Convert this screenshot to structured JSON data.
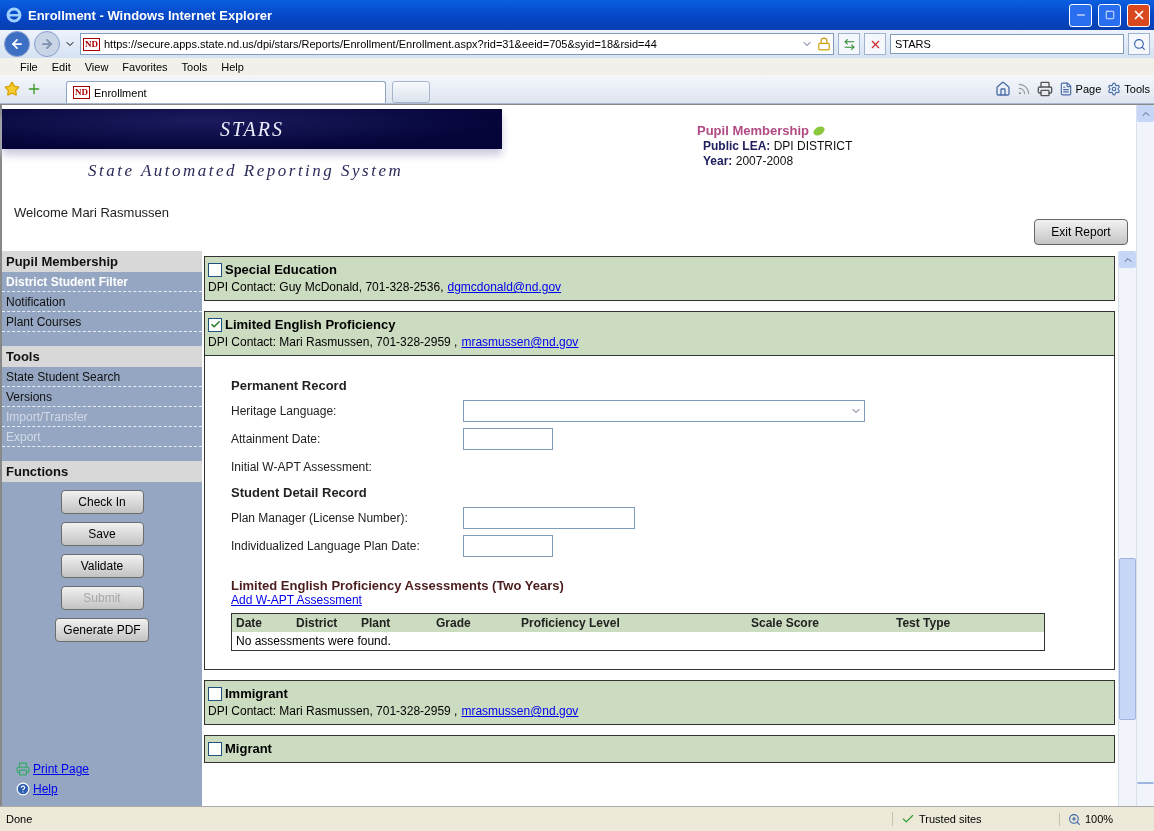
{
  "window": {
    "title": "Enrollment - Windows Internet Explorer"
  },
  "address_bar": {
    "site_badge": "ND",
    "url": "https://secure.apps.state.nd.us/dpi/stars/Reports/Enrollment/Enrollment.aspx?rid=31&eeid=705&syid=18&rsid=44",
    "search": "STARS"
  },
  "menu": [
    "File",
    "Edit",
    "View",
    "Favorites",
    "Tools",
    "Help"
  ],
  "tab": {
    "site_badge": "ND",
    "label": "Enrollment"
  },
  "command_bar": [
    "Page",
    "Tools"
  ],
  "header": {
    "logo_title": "STARS",
    "logo_subtitle": "State Automated Reporting System",
    "welcome": "Welcome Mari Rasmussen",
    "report_title": "Pupil Membership",
    "lea_label": "Public LEA:",
    "lea_value": "DPI DISTRICT",
    "year_label": "Year:",
    "year_value": "2007-2008",
    "exit_button": "Exit Report"
  },
  "sidebar": {
    "groups": [
      {
        "title": "Pupil Membership",
        "items": [
          {
            "label": "District Student Filter",
            "selected": true,
            "disabled": false
          },
          {
            "label": "Notification",
            "selected": false,
            "disabled": false
          },
          {
            "label": "Plant Courses",
            "selected": false,
            "disabled": false
          }
        ]
      },
      {
        "title": "Tools",
        "items": [
          {
            "label": "State Student Search",
            "selected": false,
            "disabled": false
          },
          {
            "label": "Versions",
            "selected": false,
            "disabled": false
          },
          {
            "label": "Import/Transfer",
            "selected": false,
            "disabled": true
          },
          {
            "label": "Export",
            "selected": false,
            "disabled": true
          }
        ]
      }
    ],
    "functions_title": "Functions",
    "buttons": [
      {
        "label": "Check In",
        "disabled": false
      },
      {
        "label": "Save",
        "disabled": false
      },
      {
        "label": "Validate",
        "disabled": false
      },
      {
        "label": "Submit",
        "disabled": true
      },
      {
        "label": "Generate PDF",
        "disabled": false
      }
    ],
    "links": [
      {
        "kind": "print",
        "label": "Print Page"
      },
      {
        "kind": "help",
        "label": "Help"
      }
    ]
  },
  "sections": [
    {
      "title": "Special Education",
      "checked": false,
      "contact": "DPI Contact: Guy McDonald, 701-328-2536,",
      "email": "dgmcdonald@nd.gov"
    },
    {
      "title": "Limited English Proficiency",
      "checked": true,
      "contact": "DPI Contact: Mari Rasmussen, 701-328-2959 ,",
      "email": "mrasmussen@nd.gov",
      "detail": {
        "blocks": [
          {
            "heading": "Permanent Record",
            "fields": [
              {
                "kind": "select",
                "label": "Heritage Language:"
              },
              {
                "kind": "date",
                "label": "Attainment Date:"
              },
              {
                "kind": "plain",
                "label": "Initial W-APT Assessment:"
              }
            ]
          },
          {
            "heading": "Student Detail Record",
            "fields": [
              {
                "kind": "text",
                "label": "Plan Manager (License Number):"
              },
              {
                "kind": "date",
                "label": "Individualized Language Plan Date:"
              }
            ]
          }
        ],
        "assessments_title": "Limited English Proficiency Assessments (Two Years)",
        "add_link": "Add W-APT Assessment",
        "table": {
          "columns": [
            "Date",
            "District",
            "Plant",
            "Grade",
            "Proficiency Level",
            "Scale Score",
            "Test Type"
          ],
          "empty": "No assessments were found."
        }
      }
    },
    {
      "title": "Immigrant",
      "checked": false,
      "contact": "DPI Contact: Mari Rasmussen, 701-328-2959 ,",
      "email": "mrasmussen@nd.gov"
    },
    {
      "title": "Migrant",
      "checked": false
    }
  ],
  "status_bar": {
    "text": "Done",
    "zone": "Trusted sites",
    "zoom": "100%"
  }
}
